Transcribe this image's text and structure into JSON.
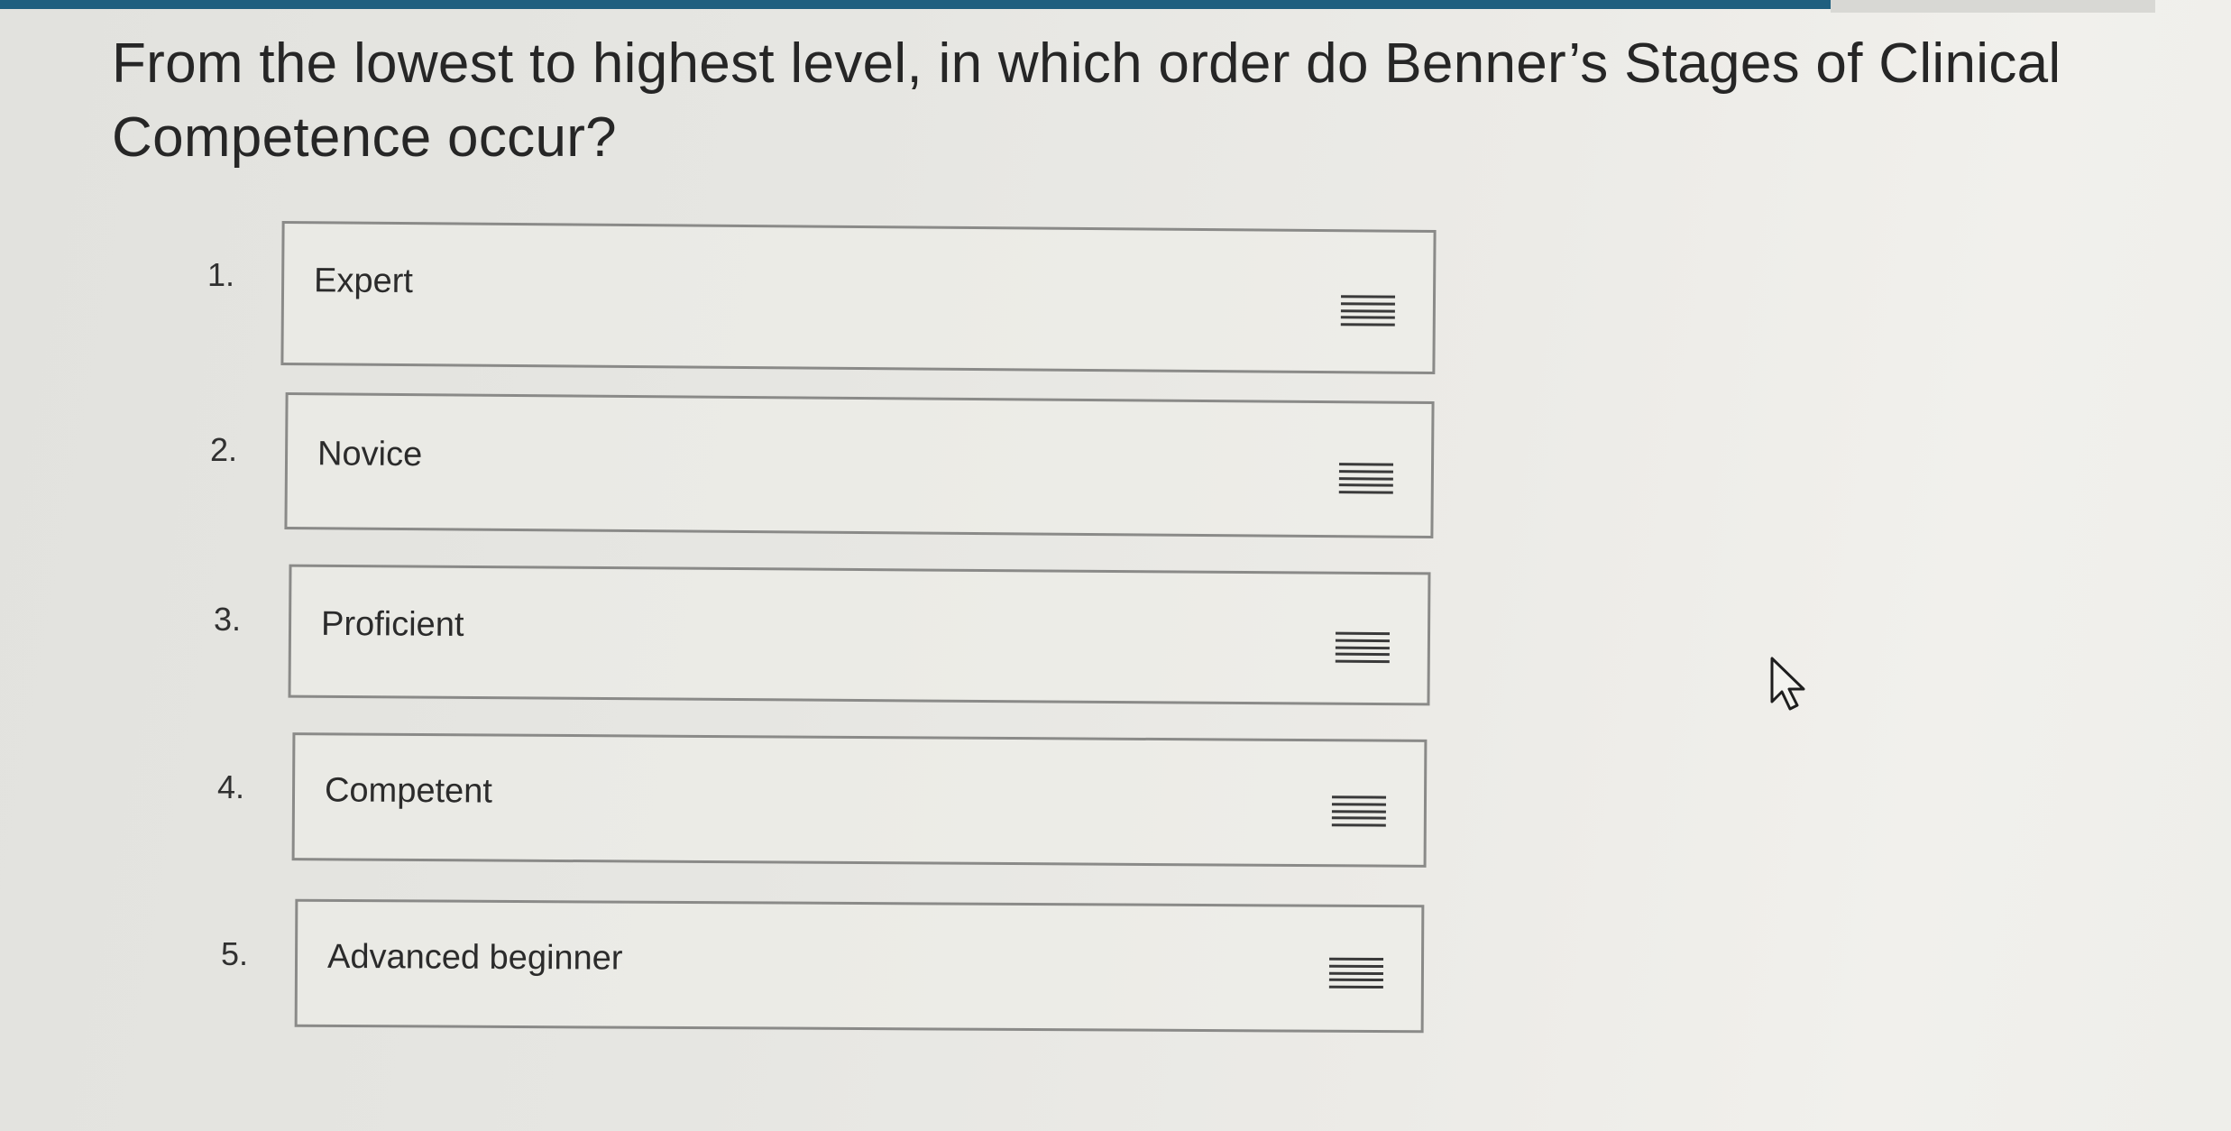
{
  "question": {
    "text": "From the lowest to highest level, in which order do Benner’s Stages of Clinical Competence occur?"
  },
  "items": [
    {
      "number": "1.",
      "label": "Expert"
    },
    {
      "number": "2.",
      "label": "Novice"
    },
    {
      "number": "3.",
      "label": "Proficient"
    },
    {
      "number": "4.",
      "label": "Competent"
    },
    {
      "number": "5.",
      "label": "Advanced beginner"
    }
  ],
  "icons": {
    "drag_handle": "drag-handle-icon",
    "cursor": "mouse-pointer-icon"
  },
  "colors": {
    "top_bar": "#1f5f7f",
    "box_border": "#8a8a88",
    "background": "#e6e6e2"
  }
}
